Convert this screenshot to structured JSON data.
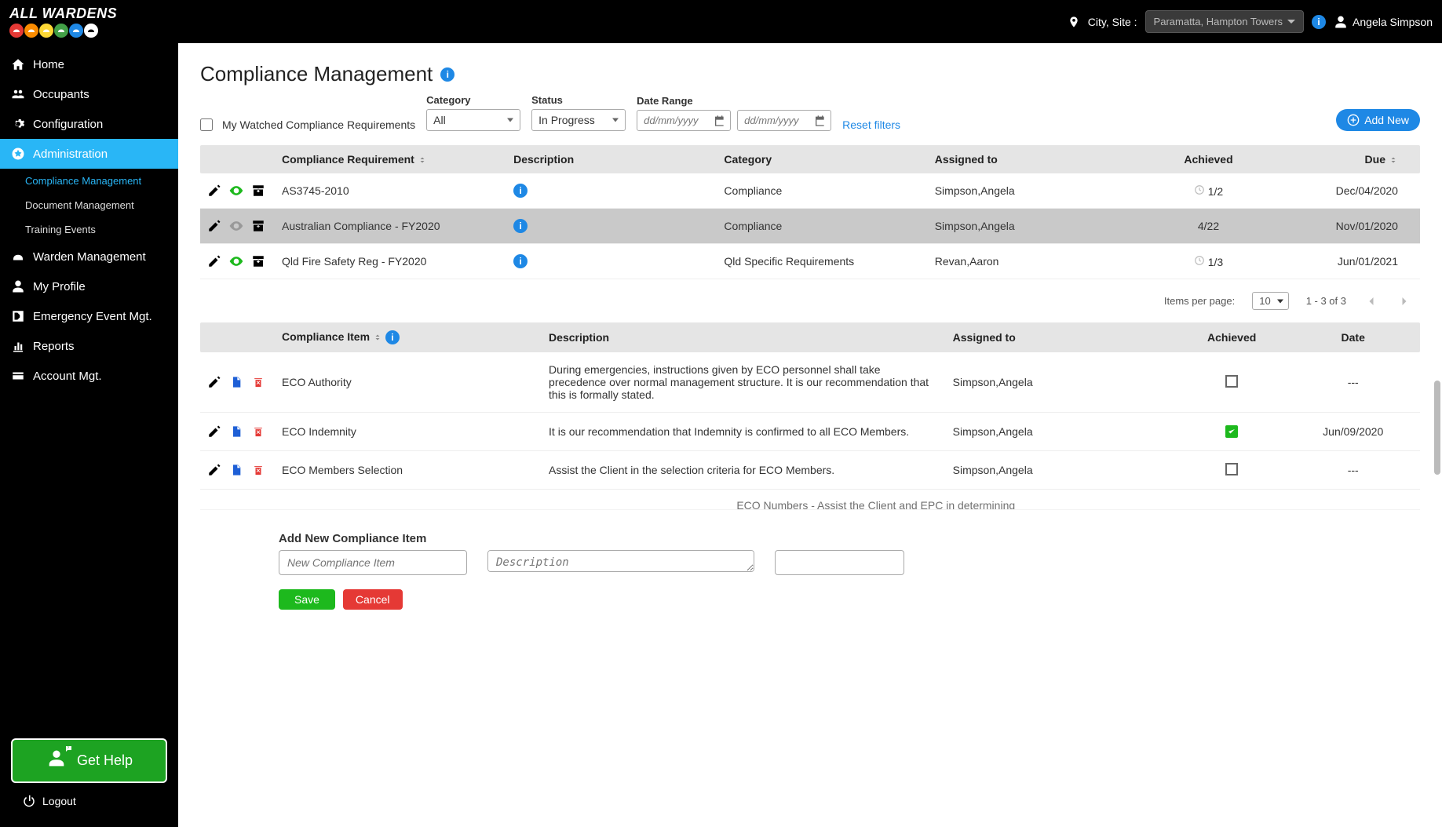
{
  "topbar": {
    "logo": "ALL WARDENS",
    "site_label": "City, Site :",
    "site_value": "Paramatta, Hampton Towers",
    "user_name": "Angela Simpson"
  },
  "sidebar": {
    "items": [
      {
        "label": "Home"
      },
      {
        "label": "Occupants"
      },
      {
        "label": "Configuration"
      },
      {
        "label": "Administration"
      },
      {
        "label": "Warden Management"
      },
      {
        "label": "My Profile"
      },
      {
        "label": "Emergency Event Mgt."
      },
      {
        "label": "Reports"
      },
      {
        "label": "Account Mgt."
      }
    ],
    "sub": [
      {
        "label": "Compliance Management"
      },
      {
        "label": "Document Management"
      },
      {
        "label": "Training Events"
      }
    ],
    "help": "Get Help",
    "logout": "Logout"
  },
  "page": {
    "title": "Compliance Management",
    "watched_label": "My Watched Compliance Requirements",
    "filters": {
      "category_label": "Category",
      "category_value": "All",
      "status_label": "Status",
      "status_value": "In Progress",
      "date_label": "Date Range",
      "date_placeholder": "dd/mm/yyyy",
      "reset": "Reset filters",
      "add_new": "Add New"
    },
    "req_table": {
      "headers": {
        "req": "Compliance Requirement",
        "desc": "Description",
        "cat": "Category",
        "assigned": "Assigned to",
        "ach": "Achieved",
        "due": "Due"
      },
      "rows": [
        {
          "req": "AS3745-2010",
          "cat": "Compliance",
          "assigned": "Simpson,Angela",
          "ach": "1/2",
          "due": "Dec/04/2020",
          "watched": true
        },
        {
          "req": "Australian Compliance - FY2020",
          "cat": "Compliance",
          "assigned": "Simpson,Angela",
          "ach": "4/22",
          "due": "Nov/01/2020",
          "watched": false,
          "selected": true
        },
        {
          "req": "Qld Fire Safety Reg - FY2020",
          "cat": "Qld Specific Requirements",
          "assigned": "Revan,Aaron",
          "ach": "1/3",
          "due": "Jun/01/2021",
          "watched": true
        }
      ]
    },
    "pagination": {
      "per_label": "Items per page:",
      "per_value": "10",
      "range": "1 - 3 of 3"
    },
    "item_table": {
      "headers": {
        "item": "Compliance Item",
        "desc": "Description",
        "assigned": "Assigned to",
        "ach": "Achieved",
        "date": "Date"
      },
      "rows": [
        {
          "item": "ECO Authority",
          "desc": "During emergencies, instructions given by ECO personnel shall take precedence over normal management structure. It is our recommendation that this is formally stated.",
          "assigned": "Simpson,Angela",
          "ach": false,
          "date": "---"
        },
        {
          "item": "ECO Indemnity",
          "desc": "It is our recommendation that Indemnity is confirmed to all ECO Members.",
          "assigned": "Simpson,Angela",
          "ach": true,
          "date": "Jun/09/2020"
        },
        {
          "item": "ECO Members Selection",
          "desc": "Assist the Client in the selection criteria for ECO Members.",
          "assigned": "Simpson,Angela",
          "ach": false,
          "date": "---"
        }
      ],
      "peek": "ECO Numbers - Assist the Client and EPC in determining"
    },
    "add_form": {
      "title": "Add New Compliance Item",
      "name_placeholder": "New Compliance Item",
      "desc_placeholder": "Description",
      "save": "Save",
      "cancel": "Cancel"
    }
  }
}
